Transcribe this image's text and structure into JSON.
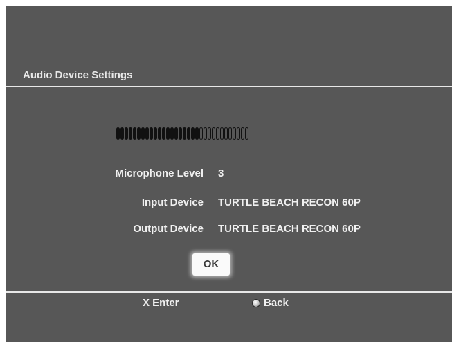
{
  "dialog": {
    "title": "Audio Device Settings"
  },
  "meter": {
    "segments_total": 32,
    "segments_filled": 20,
    "filled_fraction": 0.625
  },
  "settings": {
    "microphone_level": {
      "label": "Microphone Level",
      "value": "3"
    },
    "input_device": {
      "label": "Input Device",
      "value": "TURTLE BEACH RECON 60P"
    },
    "output_device": {
      "label": "Output Device",
      "value": "TURTLE BEACH RECON 60P"
    }
  },
  "buttons": {
    "ok_label": "OK"
  },
  "footer": {
    "enter_label": "X Enter",
    "back_label": "Back",
    "back_icon": "circle-button-icon"
  }
}
